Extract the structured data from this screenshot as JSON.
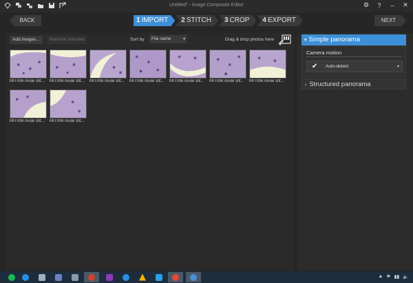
{
  "window": {
    "title": "Untitled* - Image Composite Editor"
  },
  "titlebar_icons": [
    "new-icon",
    "add-images-icon",
    "add-video-icon",
    "open-folder-icon",
    "save-icon",
    "export-icon"
  ],
  "titlebar_right": {
    "settings": "⚙",
    "help": "?",
    "minimize": "–",
    "close": "✕"
  },
  "nav": {
    "back": "BACK",
    "next": "NEXT"
  },
  "steps": [
    {
      "num": "1",
      "label": "IMPORT",
      "active": true
    },
    {
      "num": "2",
      "label": "STITCH",
      "active": false
    },
    {
      "num": "3",
      "label": "CROP",
      "active": false
    },
    {
      "num": "4",
      "label": "EXPORT",
      "active": false
    }
  ],
  "toolbar": {
    "add_images": "Add images...",
    "remove_selected": "Remove selected",
    "sort_label": "Sort by",
    "sort_value": "File name",
    "drag_drop": "Drag & drop photos here"
  },
  "thumbnails": [
    {
      "caption": "MIT006 ovule stit..."
    },
    {
      "caption": "MIT006 ovule stit..."
    },
    {
      "caption": "MIT006 ovule stit..."
    },
    {
      "caption": "MIT006 ovule stit..."
    },
    {
      "caption": "MIT006 ovule stit..."
    },
    {
      "caption": "MIT006 ovule stit..."
    },
    {
      "caption": "MIT006 ovule stit..."
    },
    {
      "caption": "MIT006 ovule stit..."
    },
    {
      "caption": "MIT006 ovule stit..."
    }
  ],
  "panel": {
    "simple": {
      "label": "Simple panorama",
      "arrow": "▾"
    },
    "camera_motion_label": "Camera motion",
    "camera_motion_value": "Auto-detect",
    "check": "✔",
    "caret": "▾",
    "structured": {
      "label": "Structured panorama",
      "arrow": "›"
    }
  },
  "taskbar": {
    "items": [
      {
        "icon": "spotify-icon",
        "color": "#1db954"
      },
      {
        "icon": "internet-explorer-icon",
        "color": "#2b8ee0"
      },
      {
        "icon": "pen-tool-icon",
        "color": "#9bb0c0"
      },
      {
        "icon": "virtual-machine-icon",
        "color": "#6d7fc0"
      },
      {
        "icon": "app-store-icon",
        "color": "#8a99a8"
      },
      {
        "icon": "snipping-tool-icon",
        "color": "#d0402f"
      },
      {
        "icon": "onenote-icon",
        "color": "#8a3ab5"
      },
      {
        "icon": "sync-icon",
        "color": "#2b8ee0"
      },
      {
        "icon": "google-drive-icon",
        "color": "#f4b400"
      },
      {
        "icon": "windows-store-icon",
        "color": "#2b9fe0"
      },
      {
        "icon": "chrome-icon",
        "color": "#e14b3b"
      },
      {
        "icon": "image-composite-editor-icon",
        "color": "#4a8fd4"
      }
    ],
    "tray": [
      "▲",
      "⚑",
      "▮▮",
      "🔈"
    ]
  }
}
